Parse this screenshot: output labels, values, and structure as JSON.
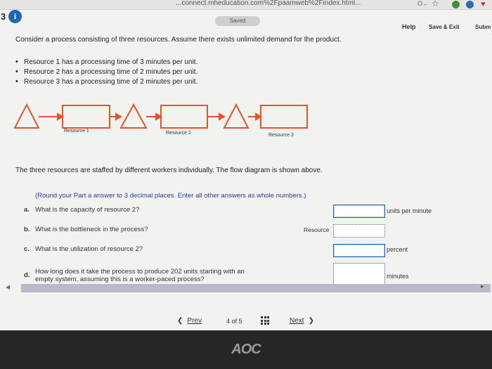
{
  "browser": {
    "url": "...connect.mheducation.com%2Fpaamweb%2Findex.html..."
  },
  "header": {
    "question_number": "3",
    "saved_label": "Saved",
    "help_label": "Help",
    "save_exit_label": "Save & Exit",
    "submit_label": "Subm"
  },
  "problem": {
    "intro": "Consider a process consisting of three resources. Assume there exists unlimited demand for the product.",
    "bullets": [
      "Resource 1 has a processing time of 3 minutes per unit.",
      "Resource 2 has a processing time of 2 minutes per unit.",
      "Resource 3 has a processing time of 2 minutes per unit."
    ],
    "flow": {
      "resource1_label": "Resource 1",
      "resource2_label": "Resource 2",
      "resource3_label": "Resource 3",
      "color": "#e0552a"
    },
    "staffed_text": "The three resources are staffed by different workers individually. The flow diagram is shown above.",
    "round_note": "(Round your Part a answer to 3 decimal places. Enter all other answers as whole numbers.)",
    "questions": {
      "a": {
        "letter": "a.",
        "text": "What is the capacity of resource 2?",
        "unit": "units per minute",
        "value": ""
      },
      "b": {
        "letter": "b.",
        "text": "What is the bottleneck in the process?",
        "prefix": "Resource",
        "value": ""
      },
      "c": {
        "letter": "c.",
        "text": "What is the utilization of resource 2?",
        "unit": "percent",
        "value": ""
      },
      "d": {
        "letter": "d.",
        "line1": "How long does it take the process to produce 202 units starting with an",
        "line2": "empty system, assuming this is a worker-paced process?",
        "unit": "minutes",
        "value": ""
      }
    }
  },
  "pagination": {
    "prev_label": "Prev",
    "page_indicator": "4 of 5",
    "next_label": "Next"
  },
  "monitor": {
    "brand": "AOC"
  }
}
